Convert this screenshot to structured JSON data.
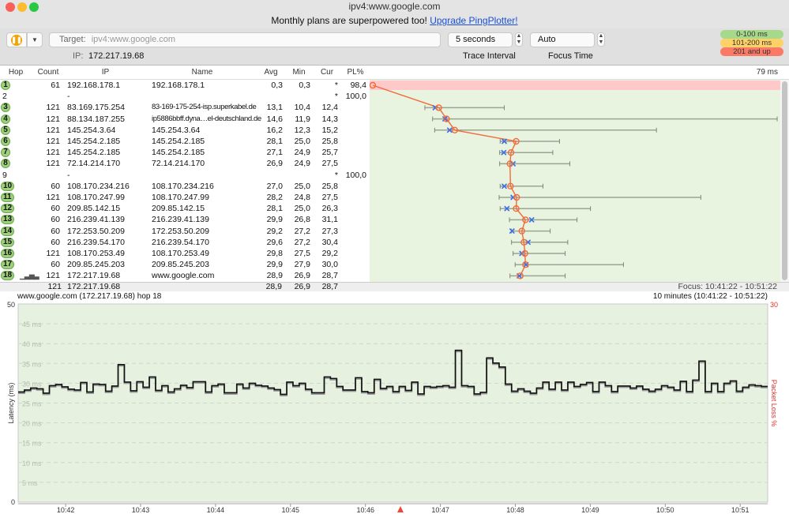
{
  "window": {
    "title": "ipv4:www.google.com"
  },
  "banner": {
    "text": "Monthly plans are superpowered too! ",
    "link": "Upgrade PingPlotter!"
  },
  "toolbar": {
    "pause_icon": "pause-icon",
    "target_label": "Target:",
    "target_value": "ipv4:www.google.com",
    "ip_label": "IP:",
    "ip_value": "172.217.19.68",
    "trace_interval": "5 seconds",
    "trace_interval_label": "Trace Interval",
    "focus_time": "Auto",
    "focus_time_label": "Focus Time",
    "legend": [
      {
        "label": "0-100 ms",
        "color": "#a6d98a"
      },
      {
        "label": "101-200 ms",
        "color": "#fcd167"
      },
      {
        "label": "201 and up",
        "color": "#fb7a66"
      }
    ]
  },
  "table": {
    "columns": [
      "Hop",
      "Count",
      "IP",
      "Name",
      "Avg",
      "Min",
      "Cur",
      "PL%"
    ],
    "scale_max_label": "79 ms",
    "rows": [
      {
        "hop": "1",
        "count": "61",
        "ip": "192.168.178.1",
        "name": "192.168.178.1",
        "avg": "0,3",
        "min": "0,3",
        "cur": "*",
        "pl": "98,4"
      },
      {
        "hop": "2",
        "count": "",
        "ip": "-",
        "name": "",
        "avg": "",
        "min": "",
        "cur": "*",
        "pl": "100,0"
      },
      {
        "hop": "3",
        "count": "121",
        "ip": "83.169.175.254",
        "name": "83-169-175-254-isp.superkabel.de",
        "avg": "13,1",
        "min": "10,4",
        "cur": "12,4",
        "pl": ""
      },
      {
        "hop": "4",
        "count": "121",
        "ip": "88.134.187.255",
        "name": "ip5886bbff.dyna…el-deutschland.de",
        "avg": "14,6",
        "min": "11,9",
        "cur": "14,3",
        "pl": ""
      },
      {
        "hop": "5",
        "count": "121",
        "ip": "145.254.3.64",
        "name": "145.254.3.64",
        "avg": "16,2",
        "min": "12,3",
        "cur": "15,2",
        "pl": ""
      },
      {
        "hop": "6",
        "count": "121",
        "ip": "145.254.2.185",
        "name": "145.254.2.185",
        "avg": "28,1",
        "min": "25,0",
        "cur": "25,8",
        "pl": ""
      },
      {
        "hop": "7",
        "count": "121",
        "ip": "145.254.2.185",
        "name": "145.254.2.185",
        "avg": "27,1",
        "min": "24,9",
        "cur": "25,7",
        "pl": ""
      },
      {
        "hop": "8",
        "count": "121",
        "ip": "72.14.214.170",
        "name": "72.14.214.170",
        "avg": "26,9",
        "min": "24,9",
        "cur": "27,5",
        "pl": ""
      },
      {
        "hop": "9",
        "count": "",
        "ip": "-",
        "name": "",
        "avg": "",
        "min": "",
        "cur": "*",
        "pl": "100,0"
      },
      {
        "hop": "10",
        "count": "60",
        "ip": "108.170.234.216",
        "name": "108.170.234.216",
        "avg": "27,0",
        "min": "25,0",
        "cur": "25,8",
        "pl": ""
      },
      {
        "hop": "11",
        "count": "121",
        "ip": "108.170.247.99",
        "name": "108.170.247.99",
        "avg": "28,2",
        "min": "24,8",
        "cur": "27,5",
        "pl": ""
      },
      {
        "hop": "12",
        "count": "60",
        "ip": "209.85.142.15",
        "name": "209.85.142.15",
        "avg": "28,1",
        "min": "25,0",
        "cur": "26,3",
        "pl": ""
      },
      {
        "hop": "13",
        "count": "60",
        "ip": "216.239.41.139",
        "name": "216.239.41.139",
        "avg": "29,9",
        "min": "26,8",
        "cur": "31,1",
        "pl": ""
      },
      {
        "hop": "14",
        "count": "60",
        "ip": "172.253.50.209",
        "name": "172.253.50.209",
        "avg": "29,2",
        "min": "27,2",
        "cur": "27,3",
        "pl": ""
      },
      {
        "hop": "15",
        "count": "60",
        "ip": "216.239.54.170",
        "name": "216.239.54.170",
        "avg": "29,6",
        "min": "27,2",
        "cur": "30,4",
        "pl": ""
      },
      {
        "hop": "16",
        "count": "121",
        "ip": "108.170.253.49",
        "name": "108.170.253.49",
        "avg": "29,8",
        "min": "27,5",
        "cur": "29,2",
        "pl": ""
      },
      {
        "hop": "17",
        "count": "60",
        "ip": "209.85.245.203",
        "name": "209.85.245.203",
        "avg": "29,9",
        "min": "27,9",
        "cur": "30,0",
        "pl": ""
      },
      {
        "hop": "18",
        "count": "121",
        "ip": "172.217.19.68",
        "name": "www.google.com",
        "avg": "28,9",
        "min": "26,9",
        "cur": "28,7",
        "pl": "",
        "graph_icon": "bar-chart-icon"
      }
    ],
    "summary": {
      "count": "121",
      "ip": "172.217.19.68",
      "avg": "28,9",
      "min": "26,9",
      "cur": "28,7"
    },
    "focus_label": "Focus: 10:41:22 - 10:51:22"
  },
  "chart_data": [
    {
      "type": "scatter",
      "title": "",
      "xlabel": "",
      "xlim": [
        0,
        79
      ],
      "unit": "ms",
      "hops": [
        "1",
        "2",
        "3",
        "4",
        "5",
        "6",
        "7",
        "8",
        "9",
        "10",
        "11",
        "12",
        "13",
        "14",
        "15",
        "16",
        "17",
        "18"
      ],
      "avg": [
        0.3,
        null,
        13.1,
        14.6,
        16.2,
        28.1,
        27.1,
        26.9,
        null,
        27.0,
        28.2,
        28.1,
        29.9,
        29.2,
        29.6,
        29.8,
        29.9,
        28.9
      ],
      "min": [
        0.3,
        null,
        10.4,
        11.9,
        12.3,
        25.0,
        24.9,
        24.9,
        null,
        25.0,
        24.8,
        25.0,
        26.8,
        27.2,
        27.2,
        27.5,
        27.9,
        26.9
      ],
      "max": [
        0.3,
        null,
        25.8,
        78.7,
        55.3,
        36.5,
        35.2,
        38.5,
        null,
        33.3,
        63.9,
        42.5,
        39.9,
        34.7,
        38.1,
        37.6,
        48.9,
        37.6
      ],
      "cur": [
        null,
        null,
        12.4,
        14.3,
        15.2,
        25.8,
        25.7,
        27.5,
        null,
        25.8,
        27.5,
        26.3,
        31.1,
        27.3,
        30.4,
        29.2,
        30.0,
        28.7
      ],
      "packet_loss": [
        98.4,
        100,
        0,
        0,
        0,
        0,
        0,
        0,
        100,
        0,
        0,
        0,
        0,
        0,
        0,
        0,
        0,
        0
      ],
      "line_color": "#f26b3a",
      "cur_color": "#3a6ee8",
      "loss_color": "#ffc9c9"
    },
    {
      "type": "line",
      "title": "www.google.com (172.217.19.68) hop 18",
      "range_label": "10 minutes (10:41:22 - 10:51:22)",
      "ylabel": "Latency (ms)",
      "y2label": "Packet Loss %",
      "ylim": [
        0,
        50
      ],
      "y2max_label": "30",
      "ymax_label": "50",
      "ymin_label": "0",
      "grid_labels": [
        "45 ms",
        "40 ms",
        "35 ms",
        "30 ms",
        "25 ms",
        "20 ms",
        "15 ms",
        "10 ms",
        "5 ms"
      ],
      "xlim": [
        "10:41:22",
        "10:51:22"
      ],
      "xticks": [
        "10:42",
        "10:43",
        "10:44",
        "10:45",
        "10:46",
        "10:47",
        "10:48",
        "10:49",
        "10:50",
        "10:51"
      ],
      "marker_time": "10:46:28",
      "values": [
        27.8,
        28.3,
        28.8,
        28.6,
        27.5,
        29.4,
        29.7,
        29.1,
        28.5,
        28.3,
        30.2,
        27.8,
        29.8,
        29.7,
        28.0,
        29.3,
        34.7,
        30.3,
        28.1,
        30.4,
        29.0,
        31.6,
        28.2,
        29.4,
        27.8,
        28.6,
        29.5,
        28.9,
        30.4,
        30.4,
        27.8,
        29.4,
        29.8,
        27.6,
        27.6,
        29.8,
        28.8,
        30.0,
        29.5,
        29.3,
        28.8,
        28.4,
        27.2,
        30.3,
        29.4,
        30.0,
        28.5,
        27.6,
        27.6,
        31.6,
        31.2,
        29.2,
        28.3,
        28.3,
        31.4,
        27.9,
        27.6,
        31.0,
        28.7,
        29.2,
        27.9,
        29.2,
        28.2,
        30.3,
        27.3,
        29.2,
        29.0,
        29.2,
        29.4,
        29.0,
        38.3,
        29.4,
        29.2,
        27.3,
        27.7,
        36.4,
        35.1,
        34.1,
        29.8,
        28.0,
        28.6,
        28.0,
        27.5,
        28.8,
        30.3,
        28.5,
        30.3,
        28.3,
        30.3,
        29.2,
        29.7,
        30.2,
        27.9,
        30.3,
        29.4,
        27.9,
        29.3,
        29.3,
        28.8,
        29.3,
        28.5,
        28.0,
        28.5,
        29.4,
        29.0,
        28.3,
        30.5,
        27.9,
        30.8,
        35.6,
        27.9,
        30.0,
        27.9,
        30.0,
        30.6,
        28.0,
        29.0,
        29.6,
        29.4,
        29.2
      ],
      "background": "#e6f1df",
      "y2_color": "#e0302a"
    }
  ]
}
